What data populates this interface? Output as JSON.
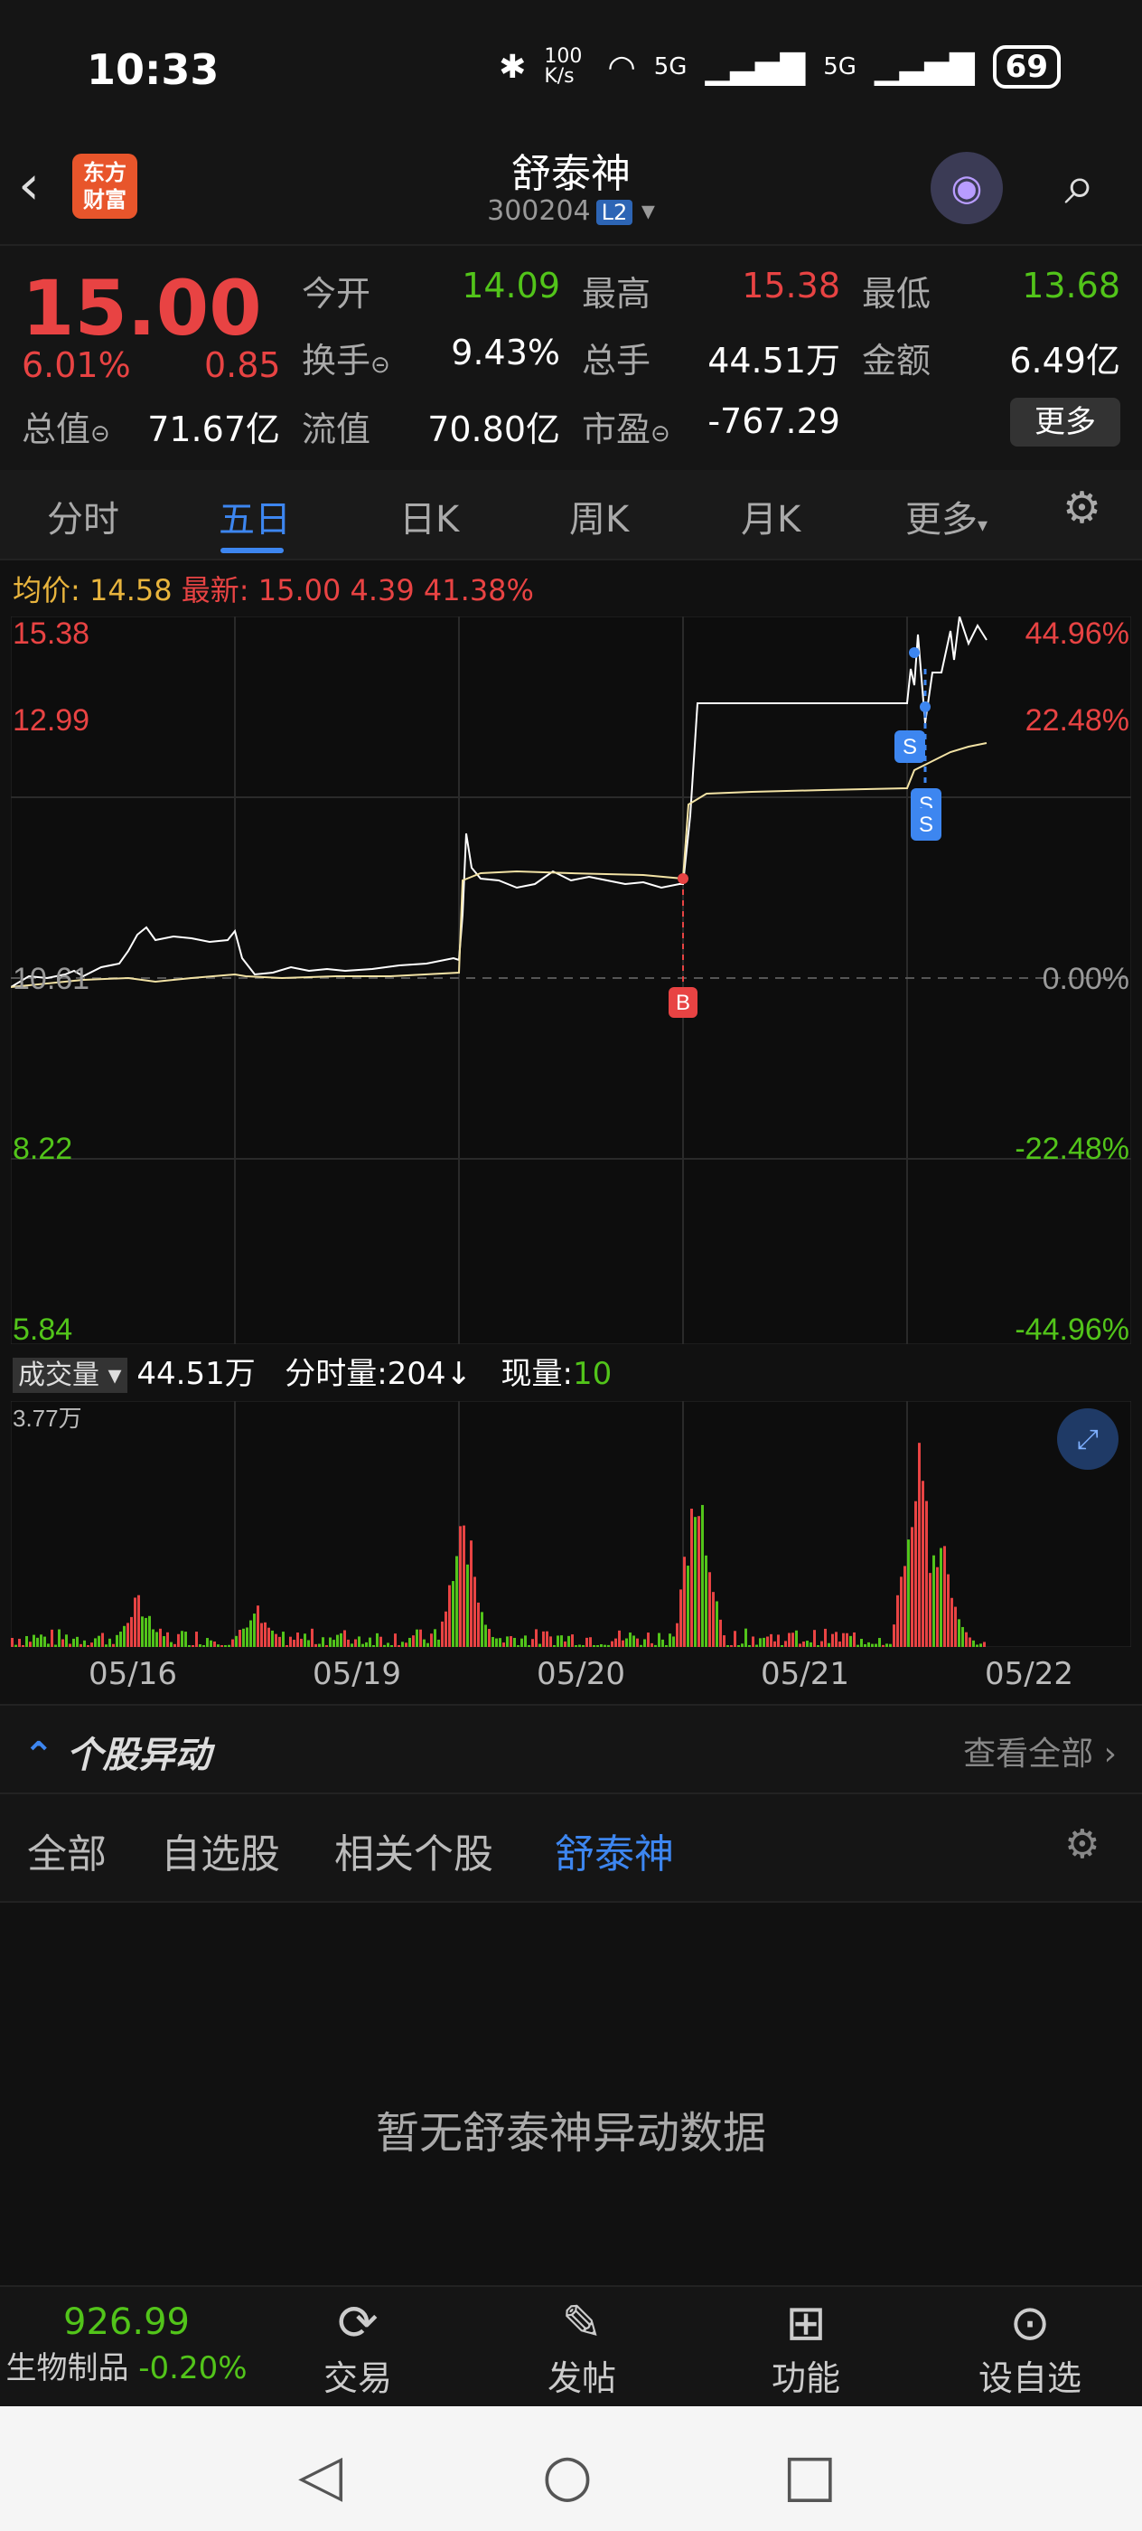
{
  "status_bar": {
    "time": "10:33",
    "speed": "100 K/s",
    "net1": "5G",
    "net2": "5G",
    "battery": "69"
  },
  "header": {
    "title": "舒泰神",
    "code": "300204",
    "badge": "L2",
    "logo_text": "东方\n财富"
  },
  "quote": {
    "price": "15.00",
    "change_pct": "6.01%",
    "change": "0.85",
    "fields": [
      {
        "label": "今开",
        "value": "14.09",
        "color": "green"
      },
      {
        "label": "最高",
        "value": "15.38",
        "color": "red"
      },
      {
        "label": "最低",
        "value": "13.68",
        "color": "green"
      },
      {
        "label": "换手",
        "value": "9.43%",
        "color": "white"
      },
      {
        "label": "总手",
        "value": "44.51万",
        "color": "white"
      },
      {
        "label": "金额",
        "value": "6.49亿",
        "color": "white"
      },
      {
        "label": "总值",
        "value": "71.67亿",
        "color": "white"
      },
      {
        "label": "流值",
        "value": "70.80亿",
        "color": "white"
      },
      {
        "label": "市盈",
        "value": "-767.29",
        "color": "white"
      }
    ],
    "more": "更多"
  },
  "tabs": [
    "分时",
    "五日",
    "日K",
    "周K",
    "月K",
    "更多"
  ],
  "active_tab": "五日",
  "avg_line": {
    "avg_label": "均价:",
    "avg": "14.58",
    "latest_label": "最新:",
    "latest": "15.00",
    "chg": "4.39",
    "pct": "41.38%"
  },
  "chart": {
    "y_left": [
      "15.38",
      "12.99",
      "10.61",
      "8.22",
      "5.84"
    ],
    "y_right": [
      "44.96%",
      "22.48%",
      "0.00%",
      "-22.48%",
      "-44.96%"
    ],
    "markers": {
      "buy": "B",
      "sell": "S"
    }
  },
  "volume": {
    "label": "成交量",
    "total": "44.51万",
    "period_label": "分时量:",
    "period": "204↓",
    "now_label": "现量:",
    "now": "10",
    "max": "3.77万"
  },
  "dates": [
    "05/16",
    "05/19",
    "05/20",
    "05/21",
    "05/22"
  ],
  "section": {
    "title": "个股异动",
    "view_all": "查看全部"
  },
  "filters": [
    "全部",
    "自选股",
    "相关个股",
    "舒泰神"
  ],
  "active_filter": "舒泰神",
  "empty_text": "暂无舒泰神异动数据",
  "bottom": {
    "index_value": "926.99",
    "index_name": "生物制品",
    "index_chg": "-0.20%",
    "items": [
      "交易",
      "发帖",
      "功能",
      "设自选"
    ]
  }
}
